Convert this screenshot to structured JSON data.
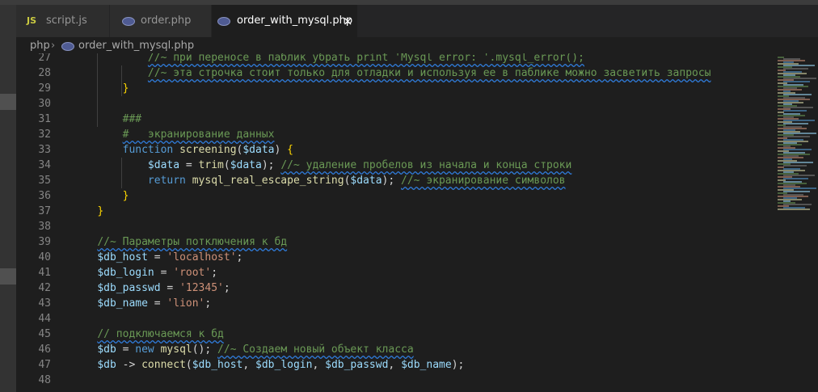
{
  "tabs": [
    {
      "label": "script.js",
      "icon": "js-icon",
      "icon_text": "JS",
      "active": false
    },
    {
      "label": "order.php",
      "icon": "php-icon",
      "active": false
    },
    {
      "label": "order_with_mysql.php",
      "icon": "php-icon",
      "active": true,
      "close": "×"
    }
  ],
  "breadcrumb": {
    "folder": "php",
    "separator": "›",
    "file": "order_with_mysql.php"
  },
  "lines": [
    {
      "n": "27",
      "t": [
        [
          "            ",
          "pn"
        ],
        [
          "//~ при переносе в паблик убрать print 'Mysql error: '.mysql_error();",
          "cm"
        ]
      ]
    },
    {
      "n": "28",
      "t": [
        [
          "            ",
          "pn"
        ],
        [
          "//~ эта строчка стоит только для отладки и используя ее в паблике можно засветить запросы",
          "cm"
        ]
      ]
    },
    {
      "n": "29",
      "t": [
        [
          "        ",
          "pn"
        ],
        [
          "}",
          "br"
        ]
      ]
    },
    {
      "n": "30",
      "t": []
    },
    {
      "n": "31",
      "t": [
        [
          "        ",
          "pn"
        ],
        [
          "###",
          "cm"
        ]
      ]
    },
    {
      "n": "32",
      "t": [
        [
          "        ",
          "pn"
        ],
        [
          "#   экранирование данных",
          "cm"
        ]
      ]
    },
    {
      "n": "33",
      "t": [
        [
          "        ",
          "pn"
        ],
        [
          "function",
          "kw"
        ],
        [
          " ",
          "pn"
        ],
        [
          "screening",
          "fn"
        ],
        [
          "(",
          "pn"
        ],
        [
          "$data",
          "var"
        ],
        [
          ") ",
          "pn"
        ],
        [
          "{",
          "br"
        ]
      ]
    },
    {
      "n": "34",
      "t": [
        [
          "            ",
          "pn"
        ],
        [
          "$data",
          "var"
        ],
        [
          " = ",
          "pn"
        ],
        [
          "trim",
          "fn"
        ],
        [
          "(",
          "pn"
        ],
        [
          "$data",
          "var"
        ],
        [
          "); ",
          "pn"
        ],
        [
          "//~ удаление пробелов из начала и конца строки",
          "cm"
        ]
      ]
    },
    {
      "n": "35",
      "t": [
        [
          "            ",
          "pn"
        ],
        [
          "return",
          "kw"
        ],
        [
          " ",
          "pn"
        ],
        [
          "mysql_real_escape_string",
          "fn"
        ],
        [
          "(",
          "pn"
        ],
        [
          "$data",
          "var"
        ],
        [
          "); ",
          "pn"
        ],
        [
          "//~ экранирование символов",
          "cm"
        ]
      ]
    },
    {
      "n": "36",
      "t": [
        [
          "        ",
          "pn"
        ],
        [
          "}",
          "br"
        ]
      ]
    },
    {
      "n": "37",
      "t": [
        [
          "    ",
          "pn"
        ],
        [
          "}",
          "br"
        ]
      ]
    },
    {
      "n": "38",
      "t": []
    },
    {
      "n": "39",
      "t": [
        [
          "    ",
          "pn"
        ],
        [
          "//~ Параметры потключения к бд",
          "cm"
        ]
      ]
    },
    {
      "n": "40",
      "t": [
        [
          "    ",
          "pn"
        ],
        [
          "$db_host",
          "var"
        ],
        [
          " = ",
          "pn"
        ],
        [
          "'localhost'",
          "str"
        ],
        [
          ";",
          "pn"
        ]
      ]
    },
    {
      "n": "41",
      "t": [
        [
          "    ",
          "pn"
        ],
        [
          "$db_login",
          "var"
        ],
        [
          " = ",
          "pn"
        ],
        [
          "'root'",
          "str"
        ],
        [
          ";",
          "pn"
        ]
      ]
    },
    {
      "n": "42",
      "t": [
        [
          "    ",
          "pn"
        ],
        [
          "$db_passwd",
          "var"
        ],
        [
          " = ",
          "pn"
        ],
        [
          "'12345'",
          "str"
        ],
        [
          ";",
          "pn"
        ]
      ]
    },
    {
      "n": "43",
      "t": [
        [
          "    ",
          "pn"
        ],
        [
          "$db_name",
          "var"
        ],
        [
          " = ",
          "pn"
        ],
        [
          "'lion'",
          "str"
        ],
        [
          ";",
          "pn"
        ]
      ]
    },
    {
      "n": "44",
      "t": []
    },
    {
      "n": "45",
      "t": [
        [
          "    ",
          "pn"
        ],
        [
          "// подключаемся к бд",
          "cm"
        ]
      ]
    },
    {
      "n": "46",
      "t": [
        [
          "    ",
          "pn"
        ],
        [
          "$db",
          "var"
        ],
        [
          " = ",
          "pn"
        ],
        [
          "new",
          "kw"
        ],
        [
          " ",
          "pn"
        ],
        [
          "mysql",
          "fn"
        ],
        [
          "(); ",
          "pn"
        ],
        [
          "//~ Создаем новый объект класса",
          "cm"
        ]
      ]
    },
    {
      "n": "47",
      "t": [
        [
          "    ",
          "pn"
        ],
        [
          "$db",
          "var"
        ],
        [
          " -> ",
          "pn"
        ],
        [
          "connect",
          "fn"
        ],
        [
          "(",
          "pn"
        ],
        [
          "$db_host",
          "var"
        ],
        [
          ", ",
          "pn"
        ],
        [
          "$db_login",
          "var"
        ],
        [
          ", ",
          "pn"
        ],
        [
          "$db_passwd",
          "var"
        ],
        [
          ", ",
          "pn"
        ],
        [
          "$db_name",
          "var"
        ],
        [
          ");",
          "pn"
        ]
      ]
    },
    {
      "n": "48",
      "t": []
    }
  ],
  "colors": {
    "bg": "#1e1e1e",
    "keyword": "#569cd6",
    "function": "#dcdcaa",
    "variable": "#9cdcfe",
    "string": "#ce9178",
    "comment": "#6a9955",
    "bracket": "#ffd700"
  }
}
